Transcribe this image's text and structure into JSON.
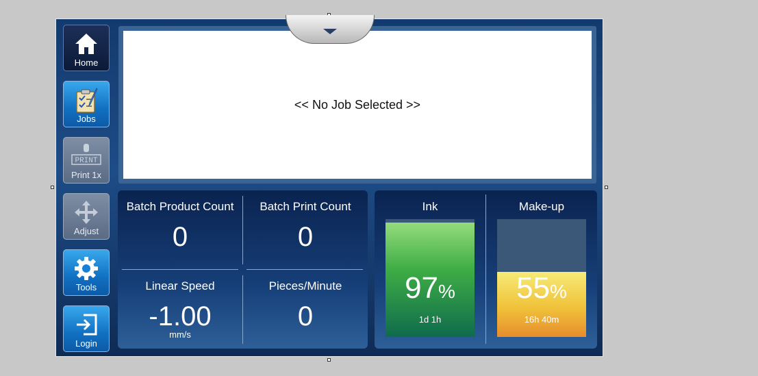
{
  "sidebar": {
    "home": {
      "label": "Home",
      "icon": "home-icon"
    },
    "jobs": {
      "label": "Jobs",
      "icon": "jobs-clipboard-icon"
    },
    "print": {
      "label": "Print 1x",
      "icon": "print-icon",
      "disabled": true
    },
    "adjust": {
      "label": "Adjust",
      "icon": "move-arrows-icon",
      "disabled": true
    },
    "tools": {
      "label": "Tools",
      "icon": "gear-icon"
    },
    "login": {
      "label": "Login",
      "icon": "login-icon"
    }
  },
  "job": {
    "message": "<< No Job Selected >>"
  },
  "counts": {
    "batch_product_count": {
      "label": "Batch Product Count",
      "value": "0"
    },
    "batch_print_count": {
      "label": "Batch Print Count",
      "value": "0"
    },
    "linear_speed": {
      "label": "Linear Speed",
      "value": "-1.00",
      "unit": "mm/s"
    },
    "pieces_per_minute": {
      "label": "Pieces/Minute",
      "value": "0"
    }
  },
  "fluids": {
    "ink": {
      "label": "Ink",
      "percent": "97",
      "percent_sign": "%",
      "remaining": "1d 1h",
      "level": 0.97
    },
    "makeup": {
      "label": "Make-up",
      "percent": "55",
      "percent_sign": "%",
      "remaining": "16h 40m",
      "level": 0.55
    }
  },
  "colors": {
    "accent": "#1170c2",
    "ink_fill": "#3fae45",
    "makeup_fill": "#f0c23a"
  }
}
